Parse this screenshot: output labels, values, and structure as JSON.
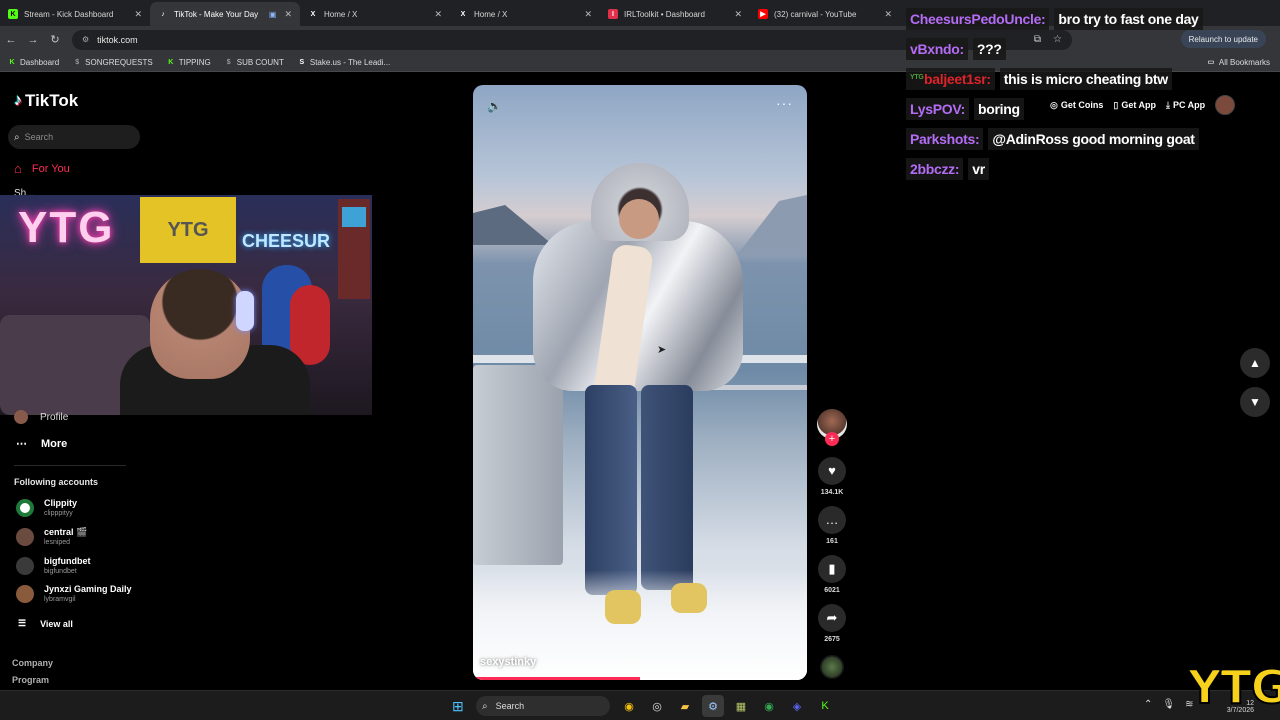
{
  "browser": {
    "tabs": [
      {
        "title": "Stream - Kick Dashboard",
        "fav": "K",
        "fav_color": "#53fc18"
      },
      {
        "title": "TikTok - Make Your Day",
        "fav": "♪",
        "fav_color": "#000000"
      },
      {
        "title": "Home / X",
        "fav": "X",
        "fav_color": "#000000"
      },
      {
        "title": "Home / X",
        "fav": "X",
        "fav_color": "#000000"
      },
      {
        "title": "IRLToolkit • Dashboard",
        "fav": "I",
        "fav_color": "#e0304a"
      },
      {
        "title": "(32) carnival - YouTube",
        "fav": "▶",
        "fav_color": "#ff0000"
      }
    ],
    "url": "tiktok.com",
    "relaunch_label": "Relaunch to update",
    "bookmarks": [
      {
        "label": "Dashboard",
        "icon": "K",
        "color": "#53fc18"
      },
      {
        "label": "SONGREQUESTS",
        "icon": "$",
        "color": "#999999"
      },
      {
        "label": "TIPPING",
        "icon": "K",
        "color": "#53fc18"
      },
      {
        "label": "SUB COUNT",
        "icon": "$",
        "color": "#999999"
      },
      {
        "label": "Stake.us - The Leadi...",
        "icon": "S",
        "color": "#ffffff"
      }
    ],
    "all_bookmarks_label": "All Bookmarks"
  },
  "tiktok": {
    "logo": "TikTok",
    "search_placeholder": "Search",
    "nav_for_you": "For You",
    "nav_partial": "Sh...",
    "nav_profile": "Profile",
    "nav_more": "More",
    "following_title": "Following accounts",
    "accounts": [
      {
        "name": "Clippity",
        "handle": "clipppityy",
        "color": "#2a2a2a"
      },
      {
        "name": "central 🎬",
        "handle": "lesniped",
        "color": "#6b4b3f"
      },
      {
        "name": "bigfundbet",
        "handle": "bigfundbet",
        "color": "#3a3a3a"
      },
      {
        "name": "Jynxzi Gaming Daily",
        "handle": "lybramvgil",
        "color": "#8a5a3c"
      }
    ],
    "view_all": "View all",
    "footer_links": [
      "Company",
      "Program"
    ],
    "top_right": {
      "get_coins": "Get Coins",
      "get_app": "Get App",
      "pc_app": "PC App"
    },
    "video": {
      "username": "sexystinky",
      "progress": 0.5,
      "likes": "134.1K",
      "comments": "161",
      "saves": "6021",
      "shares": "2675"
    }
  },
  "webcam": {
    "neon_sign": "YTG",
    "flag_text": "YTG",
    "cheese_sign": "CHEESUR"
  },
  "chat": [
    {
      "user": "CheesursPedoUncle:",
      "message": "bro try to fast one day",
      "color": "#b46cf5",
      "badge": ""
    },
    {
      "user": "vBxndo:",
      "message": "???",
      "color": "#b46cf5",
      "badge": ""
    },
    {
      "user": "baljeet1sr:",
      "message": "this is micro cheating btw",
      "color": "#e0222a",
      "badge": "YTG"
    },
    {
      "user": "LysPOV:",
      "message": "boring",
      "color": "#b46cf5",
      "badge": ""
    },
    {
      "user": "Parkshots:",
      "message": "@AdinRoss good morning goat",
      "color": "#b46cf5",
      "badge": ""
    },
    {
      "user": "2bbczz:",
      "message": "vr",
      "color": "#b46cf5",
      "badge": ""
    }
  ],
  "taskbar": {
    "search_label": "Search",
    "date": "3/7/2026",
    "time": "12"
  },
  "watermark": "YTG"
}
